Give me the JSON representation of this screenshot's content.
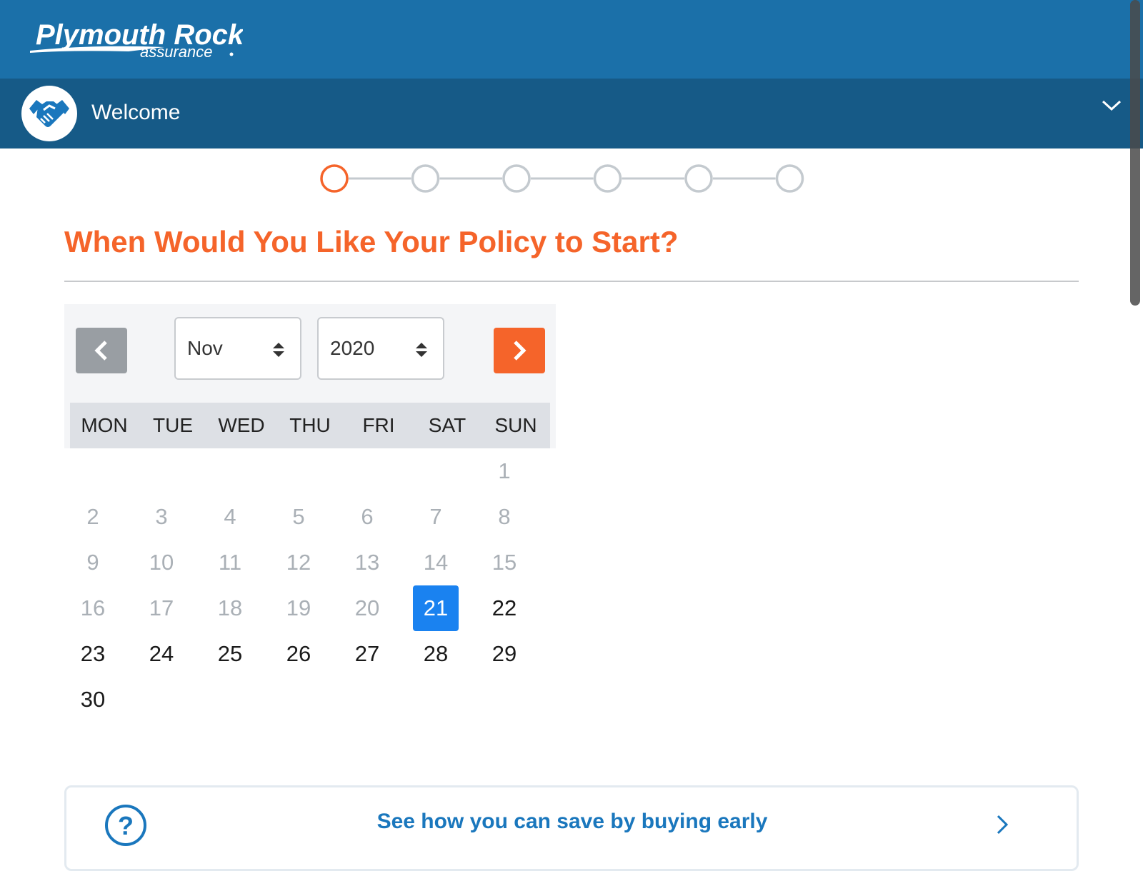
{
  "header": {
    "logo_text": "Plymouth Rock",
    "logo_subtext": "assurance",
    "brand_color": "#1b70a9"
  },
  "section": {
    "title": "Welcome",
    "icon": "handshake-icon",
    "toggle_icon": "chevron-down-icon",
    "color": "#165a87"
  },
  "progress": {
    "total_steps": 6,
    "current_step": 1,
    "active_color": "#f5642a",
    "inactive_color": "#c4cacf"
  },
  "page": {
    "title": "When Would You Like Your Policy to Start?"
  },
  "calendar": {
    "prev_icon": "chevron-left-icon",
    "next_icon": "chevron-right-icon",
    "month": "Nov",
    "year": "2020",
    "weekdays": [
      "MON",
      "TUE",
      "WED",
      "THU",
      "FRI",
      "SAT",
      "SUN"
    ],
    "weeks": [
      [
        "",
        "",
        "",
        "",
        "",
        "",
        "1"
      ],
      [
        "2",
        "3",
        "4",
        "5",
        "6",
        "7",
        "8"
      ],
      [
        "9",
        "10",
        "11",
        "12",
        "13",
        "14",
        "15"
      ],
      [
        "16",
        "17",
        "18",
        "19",
        "20",
        "21",
        "22"
      ],
      [
        "23",
        "24",
        "25",
        "26",
        "27",
        "28",
        "29"
      ],
      [
        "30",
        "",
        "",
        "",
        "",
        "",
        ""
      ]
    ],
    "selected_day": "21",
    "first_available_day": "21",
    "selected_color": "#1a82f0"
  },
  "tip": {
    "icon": "question-circle-icon",
    "text": "See how you can save by buying early",
    "arrow_icon": "chevron-right-icon"
  }
}
